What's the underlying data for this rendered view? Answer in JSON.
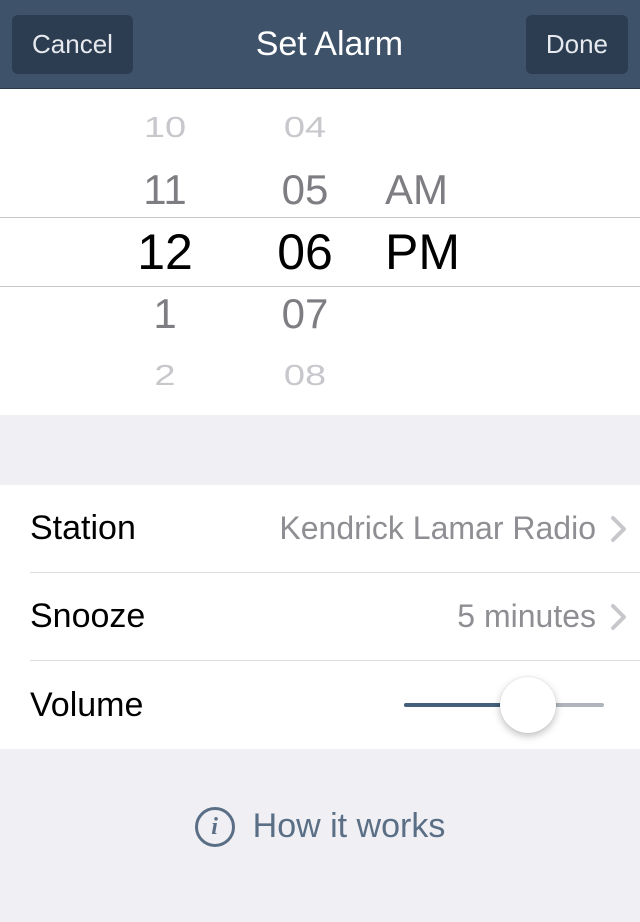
{
  "header": {
    "cancel_label": "Cancel",
    "title": "Set Alarm",
    "done_label": "Done"
  },
  "picker": {
    "hours": {
      "m2": "10",
      "m1": "11",
      "sel": "12",
      "p1": "1",
      "p2": "2"
    },
    "minutes": {
      "m2": "04",
      "m1": "05",
      "sel": "06",
      "p1": "07",
      "p2": "08"
    },
    "period": {
      "m1": "AM",
      "sel": "PM"
    }
  },
  "rows": {
    "station": {
      "label": "Station",
      "value": "Kendrick Lamar Radio"
    },
    "snooze": {
      "label": "Snooze",
      "value": "5 minutes"
    },
    "volume": {
      "label": "Volume",
      "value_pct": 62
    }
  },
  "footer": {
    "text": "How it works",
    "info_glyph": "i"
  }
}
